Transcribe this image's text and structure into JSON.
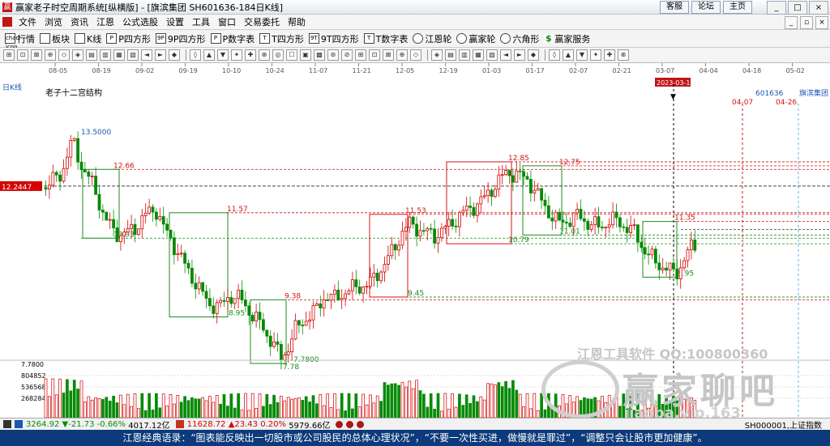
{
  "window": {
    "title": "赢家老子时空周期系统[纵横版] - [旗滨集团  SH601636-184日K线]",
    "links": [
      "客服",
      "论坛",
      "主页"
    ],
    "buttons": [
      "_",
      "□",
      "×"
    ]
  },
  "menu": [
    "文件",
    "浏览",
    "资讯",
    "江恩",
    "公式选股",
    "设置",
    "工具",
    "窗口",
    "交易委托",
    "帮助"
  ],
  "toolbar1": [
    "行情",
    "板块",
    "K线",
    "P四方形",
    "9P四方形",
    "P数字表",
    "T四方形",
    "9T四方形",
    "T数字表",
    "江恩轮",
    "赢家轮",
    "六角形",
    "赢家服务"
  ],
  "toolbar1_icons": [
    "chart-icon",
    "grid-icon",
    "kline-icon",
    "P",
    "9P",
    "P",
    "T",
    "9T",
    "T",
    "wheel-icon",
    "wheel2-icon",
    "hexagon-icon",
    "dollar-icon"
  ],
  "chart": {
    "label_daily": "日K线",
    "structure_label": "老子十二宫结构",
    "stock_name": "旗滨集团",
    "stock_code": "601636",
    "date_ticks": [
      "08-05",
      "08-19",
      "09-02",
      "09-19",
      "10-10",
      "10-24",
      "11-07",
      "11-21",
      "12-05",
      "12-19",
      "01-03",
      "01-17",
      "02-07",
      "02-21",
      "03-07",
      "04-04",
      "04-18",
      "05-02"
    ],
    "highlight_date": "2023-03-16",
    "future_dates": [
      "04-07",
      "04-26"
    ],
    "price_tag": "12.2447",
    "volume_top": "7.7800",
    "volume_ticks": [
      "804852",
      "536568",
      "268284"
    ],
    "price_labels": [
      "13.5000",
      "12.66",
      "10.93",
      "11.57",
      "8.95",
      "9.38",
      "7.7800",
      "7.78",
      "11.53",
      "9.45",
      "12.85",
      "10.79",
      "12.75",
      "11.01",
      "11.35",
      "9.95"
    ]
  },
  "chart_data": {
    "type": "candlestick",
    "symbol": "SH601636",
    "name": "旗滨集团",
    "period": "日K线",
    "annotated_levels": [
      13.5,
      12.66,
      10.93,
      11.57,
      8.95,
      9.38,
      7.78,
      11.53,
      9.45,
      12.85,
      10.79,
      12.75,
      11.01,
      11.35,
      9.95
    ],
    "current_price": 12.2447,
    "volume_axis": [
      804852,
      536568,
      268284
    ]
  },
  "watermark": {
    "tool": "江恩工具软件   QQ:100800360",
    "brand": "赢家聊吧",
    "url": "jiaoba.vip.163"
  },
  "status": {
    "index1_val": "3264.92",
    "index1_chg": "▼-21.73",
    "index1_pct": "-0.66%",
    "index1_amt": "4017.12亿",
    "index2_val": "11628.72",
    "index2_chg": "▲23.43",
    "index2_pct": "0.20%",
    "index2_amt": "5979.66亿",
    "right_info": "SH000001,上证指数"
  },
  "quote": "江恩经典语录：“图表能反映出一切股市或公司股民的总体心理状况”，“不要一次性买进，做慢就是罪过”，“调整只会让股市更加健康”。",
  "colors": {
    "up": "#d40000",
    "down": "#078a07",
    "box_red": "#d21414",
    "box_green": "#1e8c1e"
  }
}
